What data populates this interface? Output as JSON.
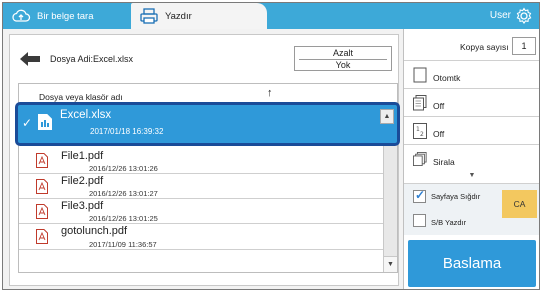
{
  "tabs": [
    {
      "label": "Bir belge tara",
      "icon": "cloud-upload-icon"
    },
    {
      "label": "Yazdır",
      "icon": "printer-icon"
    }
  ],
  "header": {
    "user": "User",
    "settings_icon": "gear-icon"
  },
  "file_bar": {
    "file_name": "Dosya Adi:Excel.xlsx",
    "sort_label": "Azalt",
    "sort_value": "Yok"
  },
  "list": {
    "header": "Dosya veya klasör adı",
    "sort_arrow": "↑",
    "selected": {
      "name": "Excel.xlsx",
      "date": "2017/01/18 16:39:32"
    },
    "items": [
      {
        "name": "File1.pdf",
        "date": "2016/12/26 13:01:26"
      },
      {
        "name": "File2.pdf",
        "date": "2016/12/26 13:01:27"
      },
      {
        "name": "File3.pdf",
        "date": "2016/12/26 13:01:25"
      },
      {
        "name": "gotolunch.pdf",
        "date": "2017/11/09 11:36:57"
      }
    ]
  },
  "settings": {
    "copies_label": "Kopya sayısı",
    "copies_value": "1",
    "options": [
      {
        "label": "Otomtk",
        "icon": "paper-size-icon"
      },
      {
        "label": "Off",
        "icon": "duplex-icon"
      },
      {
        "label": "Off",
        "icon": "n-up-icon"
      },
      {
        "label": "Sirala",
        "icon": "collate-icon"
      }
    ],
    "fit_page_label": "Sayfaya Sığdır",
    "fit_page_checked": true,
    "bw_label": "S/B Yazdır",
    "bw_checked": false,
    "ca_label": "CA",
    "start_label": "Baslama"
  },
  "colors": {
    "accent": "#3da9d8",
    "selection": "#2f99d9",
    "selection_border": "#1a4b98",
    "ca_badge": "#f3c85f"
  }
}
